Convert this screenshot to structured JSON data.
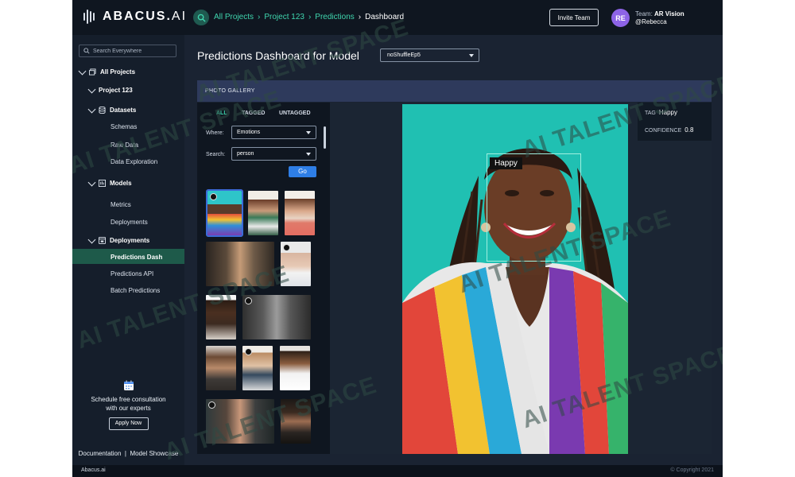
{
  "app": {
    "logo_bold": "ABACUS.",
    "logo_light": "AI",
    "watermark": "AI TALENT SPACE"
  },
  "header": {
    "breadcrumb": [
      "All Projects",
      "Project 123",
      "Predictions"
    ],
    "breadcrumb_current": "Dashboard",
    "invite_label": "Invite Team",
    "avatar_initials": "RE",
    "team_label": "Team:",
    "team_name": "AR Vision",
    "user_handle": "@Rebecca"
  },
  "sidebar": {
    "search_placeholder": "Search Everywhere",
    "items": {
      "all_projects": "All Projects",
      "project": "Project 123",
      "datasets": "Datasets",
      "schemas": "Schemas",
      "raw_data": "Raw Data",
      "data_exploration": "Data Exploration",
      "models": "Models",
      "metrics": "Metrics",
      "deployments_sub": "Deployments",
      "deployments": "Deployments",
      "predictions_dash": "Predictions Dash",
      "predictions_api": "Predictions API",
      "batch_predictions": "Batch Predictions"
    },
    "promo_line1": "Schedule free consultation",
    "promo_line2": "with our experts",
    "apply_label": "Apply Now",
    "documentation": "Documentation",
    "link_sep": "|",
    "model_showcase": "Model Showcase"
  },
  "main": {
    "title": "Predictions Dashboard for Model",
    "model_selected": "noShuffleEp5",
    "gallery_title": "PHOTO GALLERY",
    "tabs": [
      "ALL",
      "TAGGED",
      "UNTAGGED"
    ],
    "where_label": "Where:",
    "where_value": "Emotions",
    "search_label": "Search:",
    "search_value": "person",
    "go_label": "Go",
    "detection_label": "Happy",
    "info": {
      "tag_label": "TAG",
      "tag_value": "Happy",
      "confidence_label": "CONFIDENCE",
      "confidence_value": "0.8"
    }
  },
  "footer": {
    "brand": "Abacus.ai",
    "copyright": "© Copyright 2021"
  },
  "colors": {
    "accent": "#3fd6ae",
    "go_button": "#2e7ee6",
    "avatar": "#8d63e6",
    "gallery_bar": "#2e3a5c"
  }
}
